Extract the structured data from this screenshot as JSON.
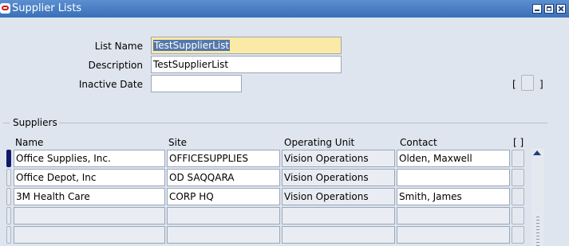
{
  "window": {
    "title": "Supplier Lists"
  },
  "form": {
    "list_name_label": "List Name",
    "list_name_value": "TestSupplierList",
    "description_label": "Description",
    "description_value": "TestSupplierList",
    "inactive_date_label": "Inactive Date",
    "inactive_date_value": "",
    "bracket_open": "[",
    "bracket_close": "]"
  },
  "suppliers": {
    "section_title": "Suppliers",
    "columns": {
      "name": "Name",
      "site": "Site",
      "operating_unit": "Operating Unit",
      "contact": "Contact",
      "flex": "[ ]"
    },
    "rows": [
      {
        "name": "Office Supplies, Inc.",
        "site": "OFFICESUPPLIES",
        "operating_unit": "Vision Operations",
        "contact": "Olden, Maxwell"
      },
      {
        "name": "Office Depot, Inc",
        "site": "OD SAQQARA",
        "operating_unit": "Vision Operations",
        "contact": ""
      },
      {
        "name": "3M Health Care",
        "site": "CORP HQ",
        "operating_unit": "Vision Operations",
        "contact": "Smith, James"
      },
      {
        "name": "",
        "site": "",
        "operating_unit": "",
        "contact": ""
      },
      {
        "name": "",
        "site": "",
        "operating_unit": "",
        "contact": ""
      }
    ]
  },
  "colors": {
    "titlebar": "#3a6fb8",
    "active_field": "#fbe9a6",
    "current_record": "#0f1a66",
    "background": "#dfe5ee"
  }
}
